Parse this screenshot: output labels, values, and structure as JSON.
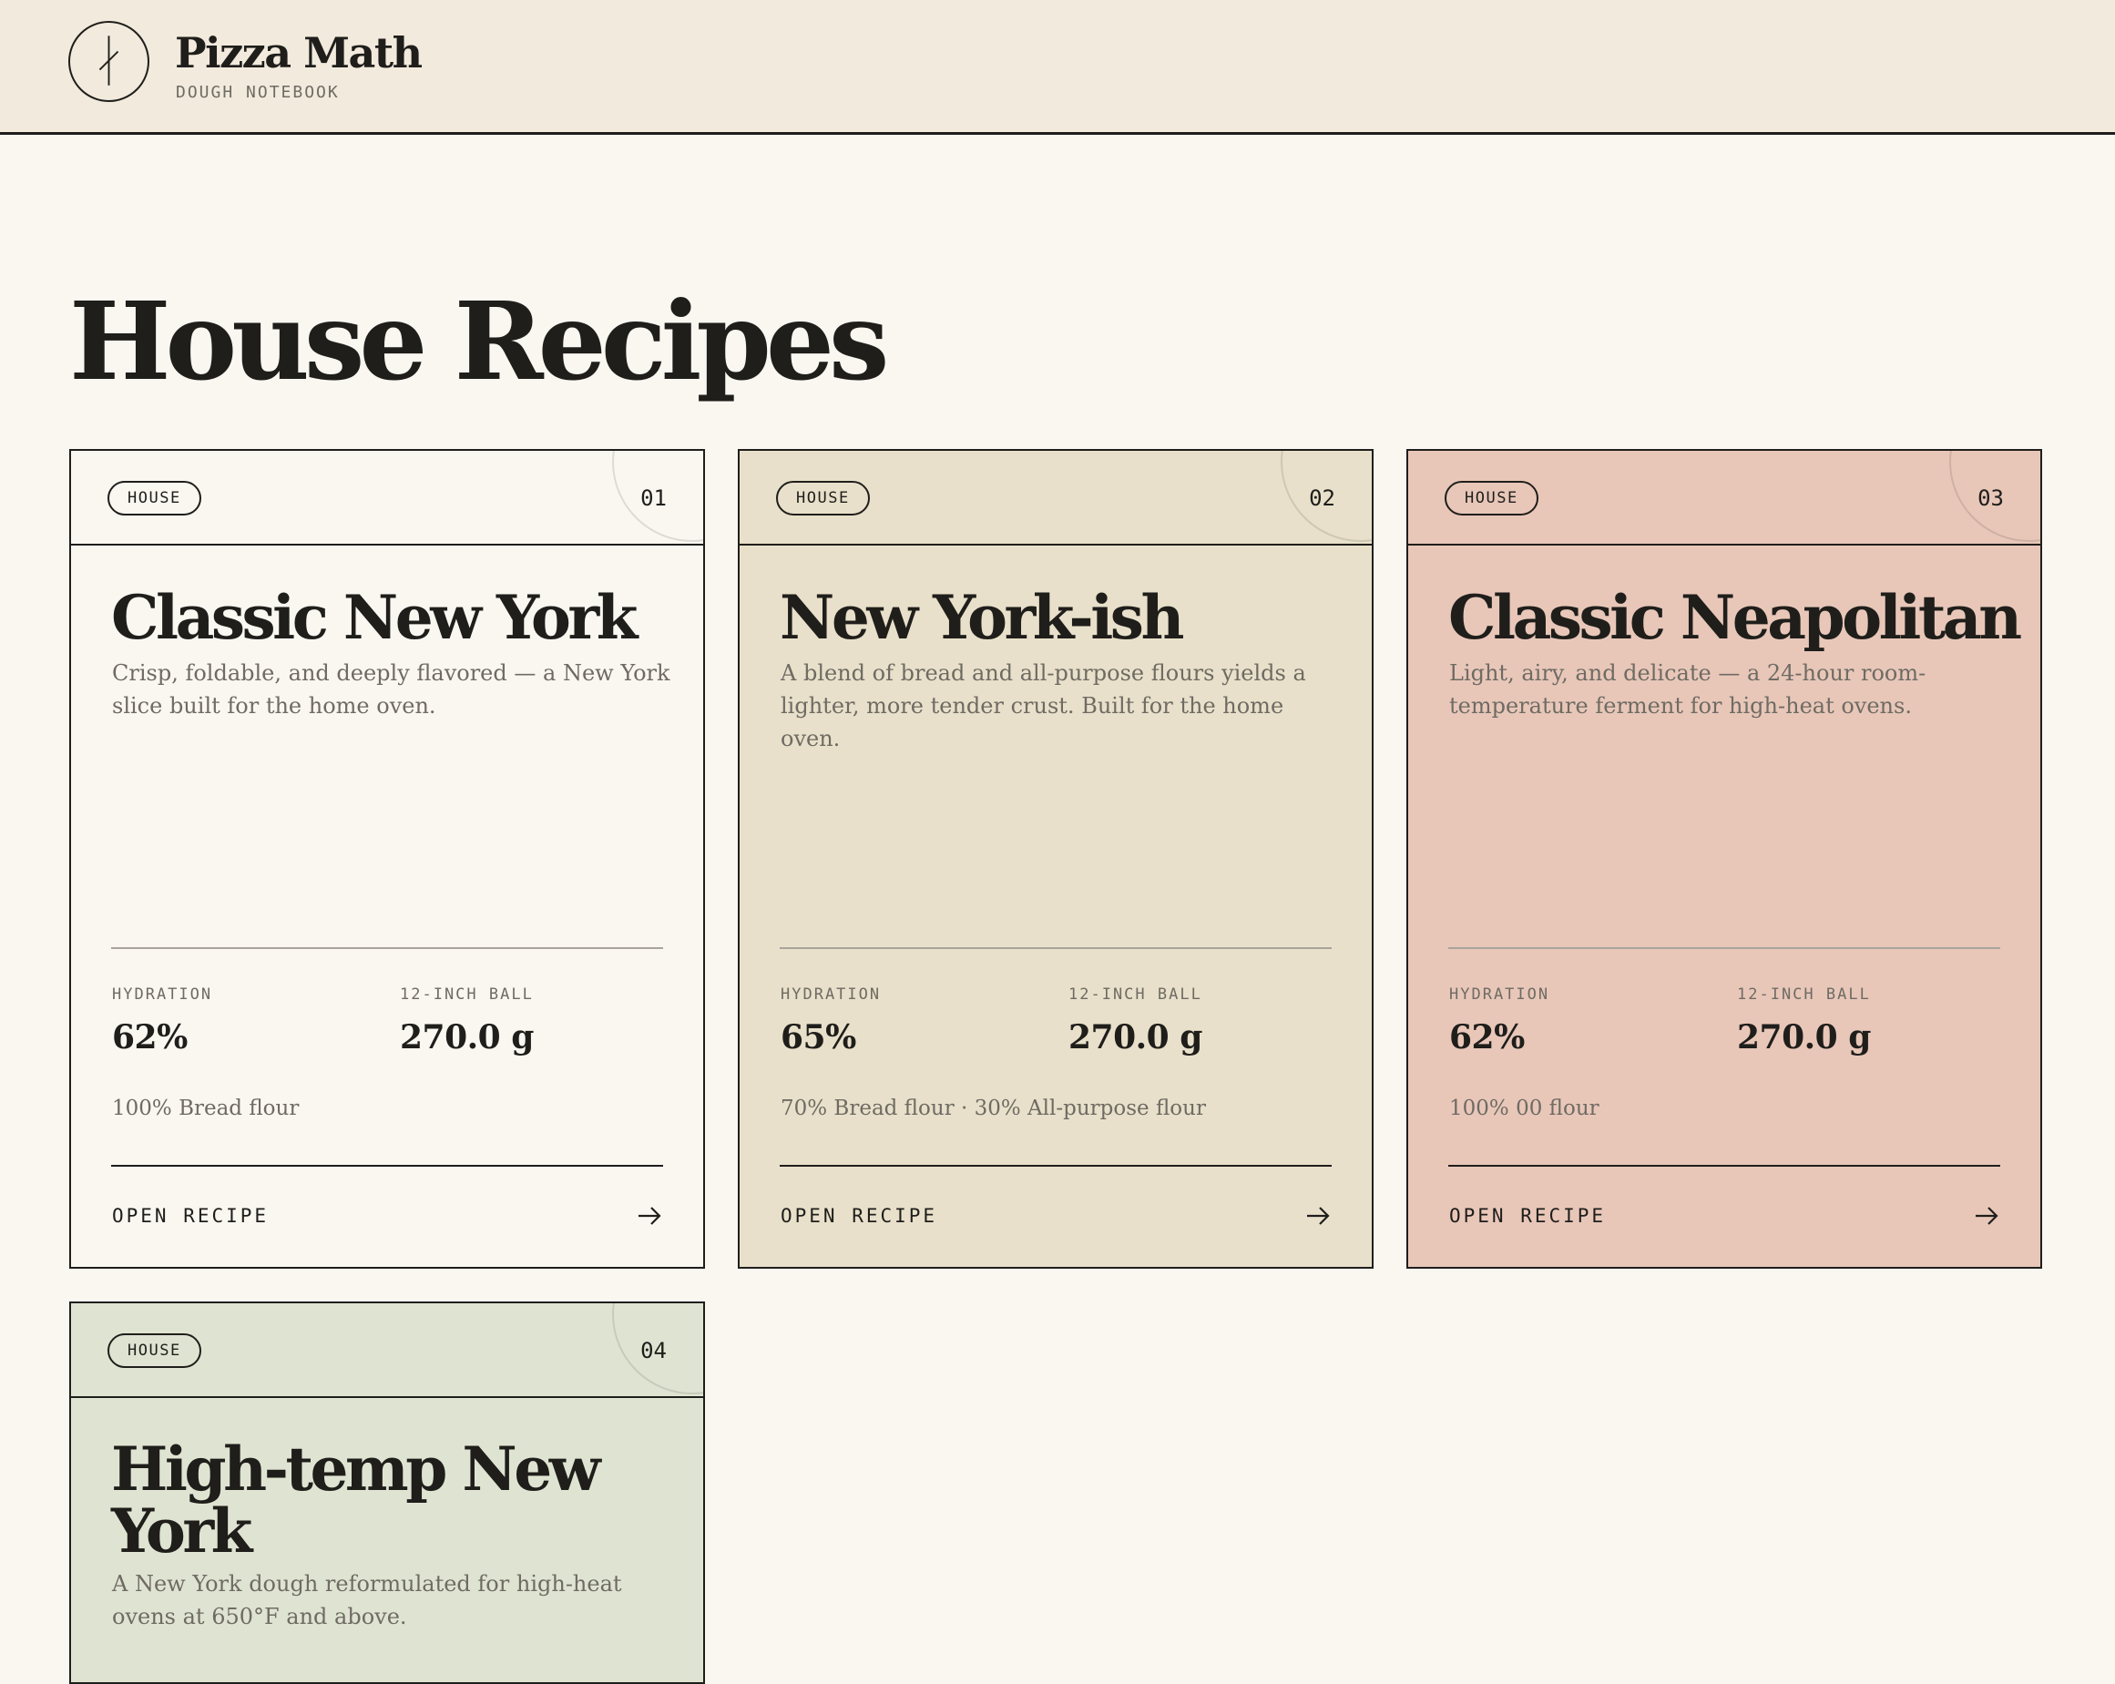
{
  "header": {
    "brand_name": "Pizza Math",
    "brand_sub": "DOUGH NOTEBOOK",
    "logo_icon": "pizza-slice-mark-icon"
  },
  "page": {
    "title": "House Recipes"
  },
  "cards": [
    {
      "badge": "HOUSE",
      "number": "01",
      "title": "Classic New York",
      "description": "Crisp, foldable, and deeply flavored — a New York slice built for the home oven.",
      "hydration_label": "HYDRATION",
      "hydration_value": "62%",
      "ball_label": "12-INCH BALL",
      "ball_value": "270.0 g",
      "flour": "100% Bread flour",
      "open_label": "OPEN RECIPE",
      "background": "#faf7f1"
    },
    {
      "badge": "HOUSE",
      "number": "02",
      "title": "New York-ish",
      "description": "A blend of bread and all-purpose flours yields a lighter, more tender crust. Built for the home oven.",
      "hydration_label": "HYDRATION",
      "hydration_value": "65%",
      "ball_label": "12-INCH BALL",
      "ball_value": "270.0 g",
      "flour": "70% Bread flour · 30% All-purpose flour",
      "open_label": "OPEN RECIPE",
      "background": "#e8e0ca"
    },
    {
      "badge": "HOUSE",
      "number": "03",
      "title": "Classic Neapolitan",
      "description": "Light, airy, and delicate — a 24-hour room-temperature ferment for high-heat ovens.",
      "hydration_label": "HYDRATION",
      "hydration_value": "62%",
      "ball_label": "12-INCH BALL",
      "ball_value": "270.0 g",
      "flour": "100% 00 flour",
      "open_label": "OPEN RECIPE",
      "background": "#e8c7b9"
    },
    {
      "badge": "HOUSE",
      "number": "04",
      "title": "High-temp New York",
      "description": "A New York dough reformulated for high-heat ovens at 650°F and above.",
      "background": "#dfe4d2"
    }
  ],
  "colors": {
    "ink": "#1f1e1b",
    "muted": "#6f6b63",
    "page_bg": "#faf7f1",
    "header_bg": "#f2eadc"
  },
  "icons": {
    "open_arrow": "arrow-right-icon"
  }
}
